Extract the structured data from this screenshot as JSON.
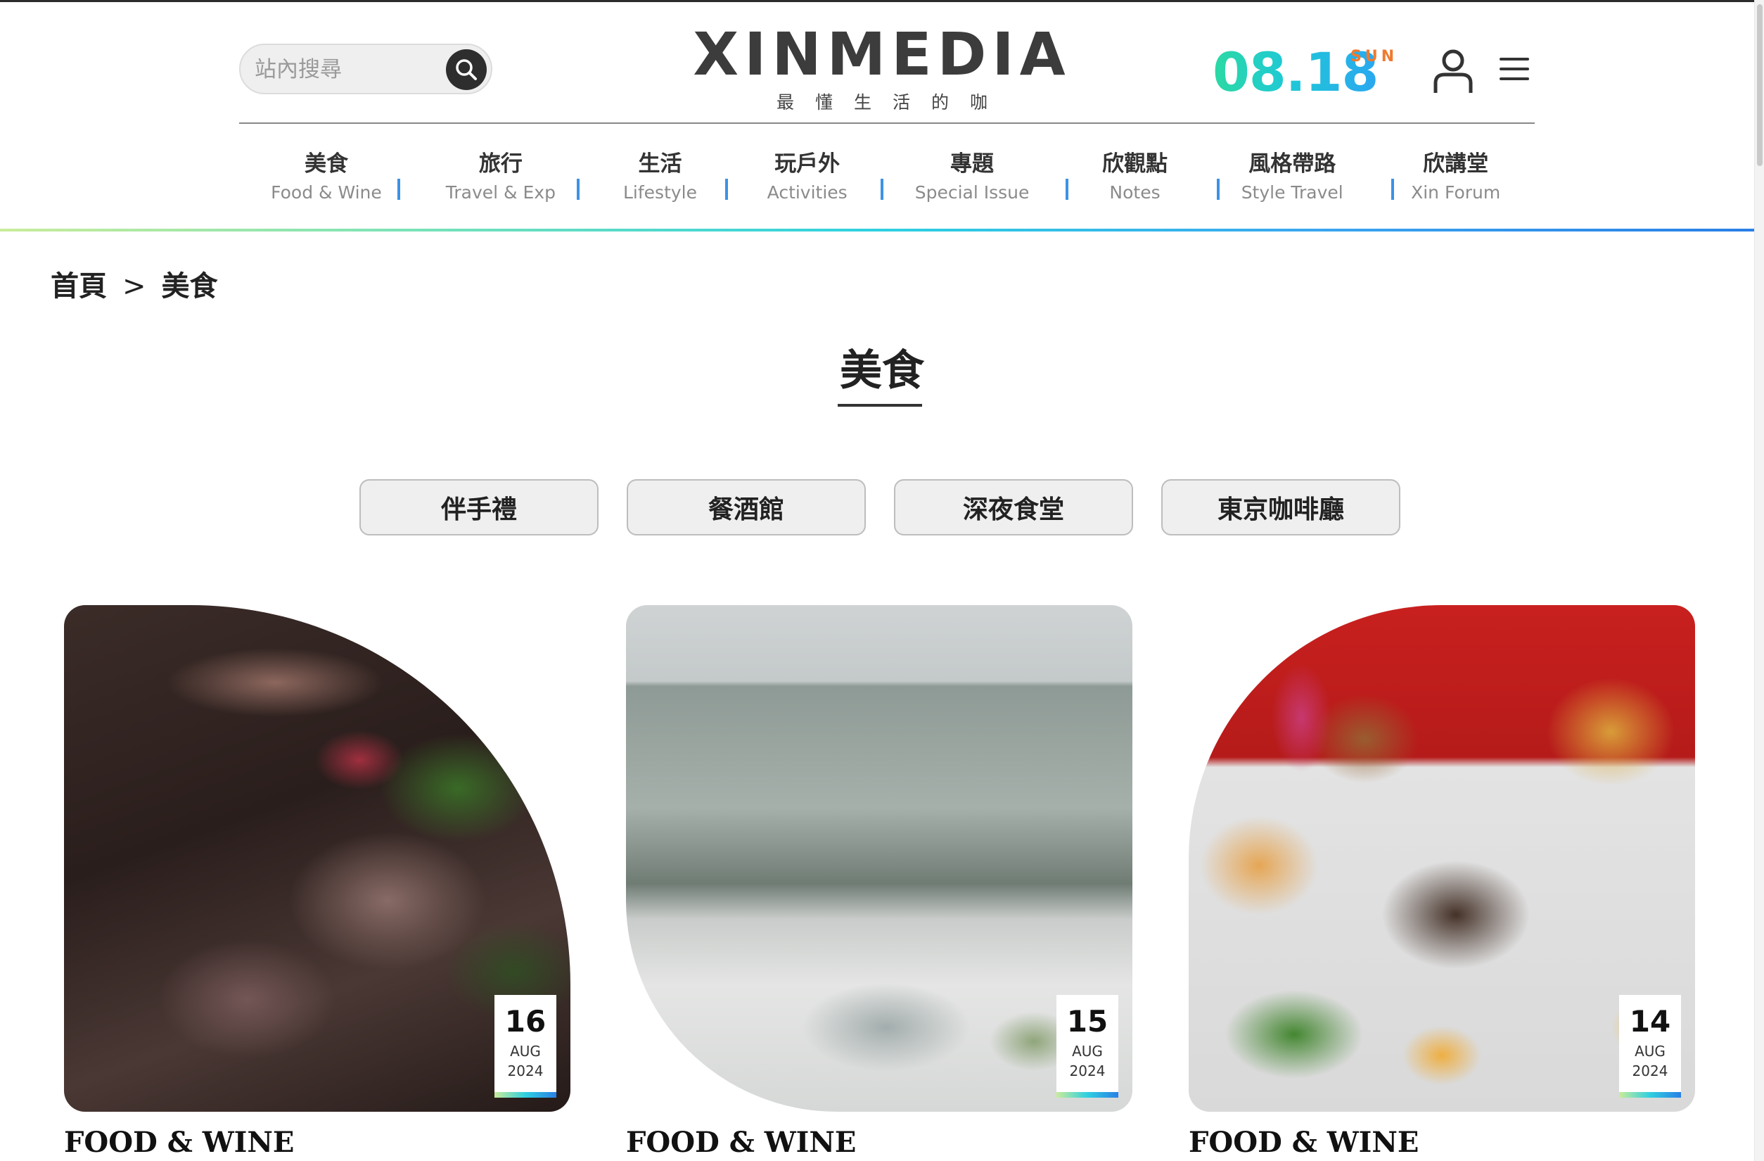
{
  "header": {
    "search_placeholder": "站內搜尋",
    "logo": "XINMEDIA",
    "tagline": "最懂生活的咖",
    "date": "08.18",
    "day": "SUN"
  },
  "nav": [
    {
      "zh": "美食",
      "en": "Food & Wine"
    },
    {
      "zh": "旅行",
      "en": "Travel & Exp"
    },
    {
      "zh": "生活",
      "en": "Lifestyle"
    },
    {
      "zh": "玩戶外",
      "en": "Activities"
    },
    {
      "zh": "專題",
      "en": "Special Issue"
    },
    {
      "zh": "欣觀點",
      "en": "Notes"
    },
    {
      "zh": "風格帶路",
      "en": "Style Travel"
    },
    {
      "zh": "欣講堂",
      "en": "Xin Forum"
    }
  ],
  "breadcrumb": {
    "home": "首頁",
    "separator": ">",
    "current": "美食"
  },
  "page_title": "美食",
  "categories": [
    "伴手禮",
    "餐酒館",
    "深夜食堂",
    "東京咖啡廳"
  ],
  "cards": [
    {
      "day": "16",
      "month": "AUG",
      "year": "2024",
      "category": "FOOD & WINE"
    },
    {
      "day": "15",
      "month": "AUG",
      "year": "2024",
      "category": "FOOD & WINE"
    },
    {
      "day": "14",
      "month": "AUG",
      "year": "2024",
      "category": "FOOD & WINE"
    }
  ],
  "colors": {
    "nav_separator": "#3c92e6",
    "date_gradient_start": "#2bd9a3",
    "date_gradient_end": "#2aa7f0",
    "day_accent": "#f07a2e"
  }
}
